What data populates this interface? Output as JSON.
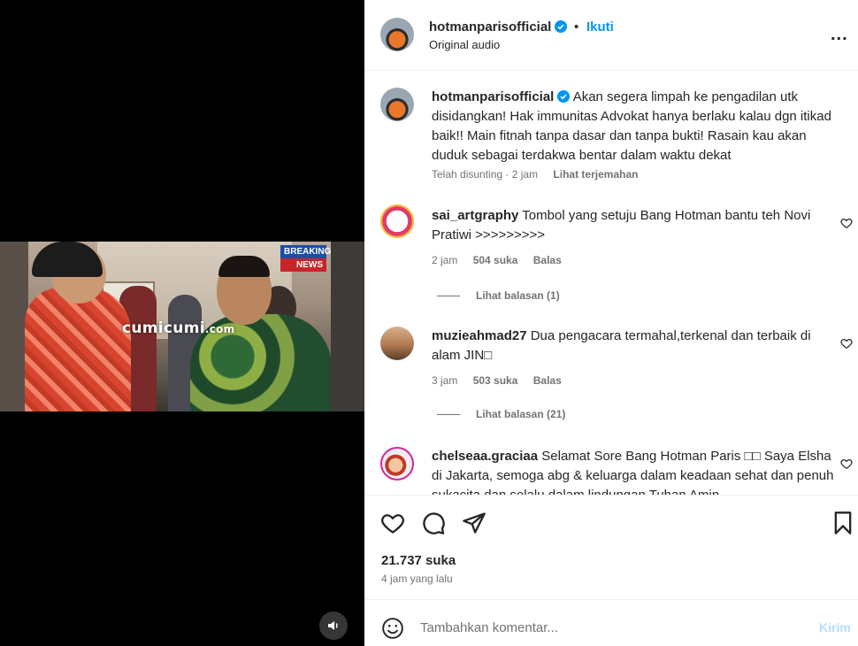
{
  "media": {
    "watermark": "cumicumi",
    "watermark_suffix": ".com",
    "badge_top": "BREAKING",
    "badge_bottom": "NEWS"
  },
  "header": {
    "username": "hotmanparisofficial",
    "separator": "•",
    "follow_label": "Ikuti",
    "audio": "Original audio",
    "more": "..."
  },
  "caption": {
    "username": "hotmanparisofficial",
    "text": "Akan segera limpah ke pengadilan utk disidangkan! Hak immunitas Advokat hanya berlaku kalau dgn itikad baik!! Main fitnah tanpa dasar dan tanpa bukti! Rasain kau akan duduk sebagai terdakwa bentar dalam waktu dekat",
    "edited": "Telah disunting · 2 jam",
    "translate": "Lihat terjemahan"
  },
  "comments": [
    {
      "username": "sai_artgraphy",
      "text": "Tombol yang setuju Bang Hotman bantu teh Novi Pratiwi >>>>>>>>>",
      "time": "2 jam",
      "likes": "504 suka",
      "reply": "Balas",
      "replies": "Lihat balasan (1)"
    },
    {
      "username": "muzieahmad27",
      "text": "Dua pengacara termahal,terkenal dan terbaik di alam JIN□",
      "time": "3 jam",
      "likes": "503 suka",
      "reply": "Balas",
      "replies": "Lihat balasan (21)"
    },
    {
      "username": "chelseaa.graciaa",
      "text": "Selamat Sore Bang Hotman Paris □□ Saya Elsha di Jakarta, semoga abg & keluarga dalam keadaan sehat dan penuh sukacita dan selalu dalam lindungan Tuhan Amin",
      "time": "",
      "likes": "",
      "reply": "",
      "replies": ""
    }
  ],
  "actions": {
    "likes": "21.737 suka",
    "time_ago": "4 jam yang lalu"
  },
  "add_comment": {
    "placeholder": "Tambahkan komentar...",
    "send_label": "Kirim"
  },
  "colors": {
    "link_blue": "#0095f6",
    "send_disabled": "#b2dffc",
    "meta_gray": "#737373",
    "text": "#262626"
  }
}
